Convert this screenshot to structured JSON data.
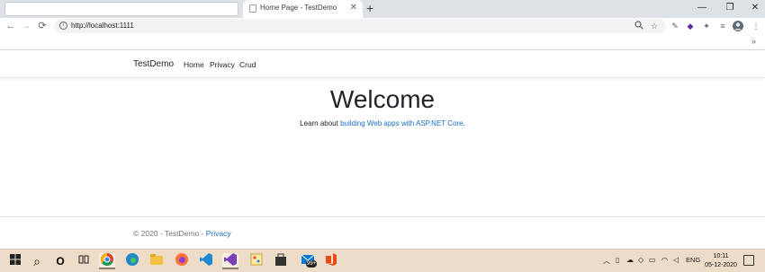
{
  "browser": {
    "tab_title": "Home Page - TestDemo",
    "tab_close": "✕",
    "new_tab": "+",
    "window_controls": [
      "—",
      "❐",
      "✕"
    ],
    "url": "http://localhost:1111",
    "back": "←",
    "forward": "→",
    "reload": "⟳",
    "bookmarks_overflow": "»"
  },
  "site": {
    "brand": "TestDemo",
    "nav": [
      "Home",
      "Privacy",
      "Crud"
    ],
    "heading": "Welcome",
    "learn_prefix": "Learn about ",
    "learn_link": "building Web apps with ASP.NET Core",
    "learn_suffix": ".",
    "footer_prefix": "© 2020 - TestDemo - ",
    "footer_link": "Privacy"
  },
  "taskbar": {
    "search_glyph": "⌕",
    "cortana_glyph": "O",
    "apps": [
      "chrome-icon",
      "edge-icon",
      "file-explorer-icon",
      "firefox-icon",
      "vscode-icon",
      "visual-studio-icon",
      "paint-icon",
      "store-icon",
      "mail-icon",
      "office-icon"
    ],
    "mail_badge": "99+",
    "language": "ENG",
    "time": "10:11",
    "date": "05-12-2020"
  },
  "colors": {
    "link": "#1b6ec2",
    "tabstrip": "#dee1e6",
    "taskbar": "#ecdcc8"
  }
}
